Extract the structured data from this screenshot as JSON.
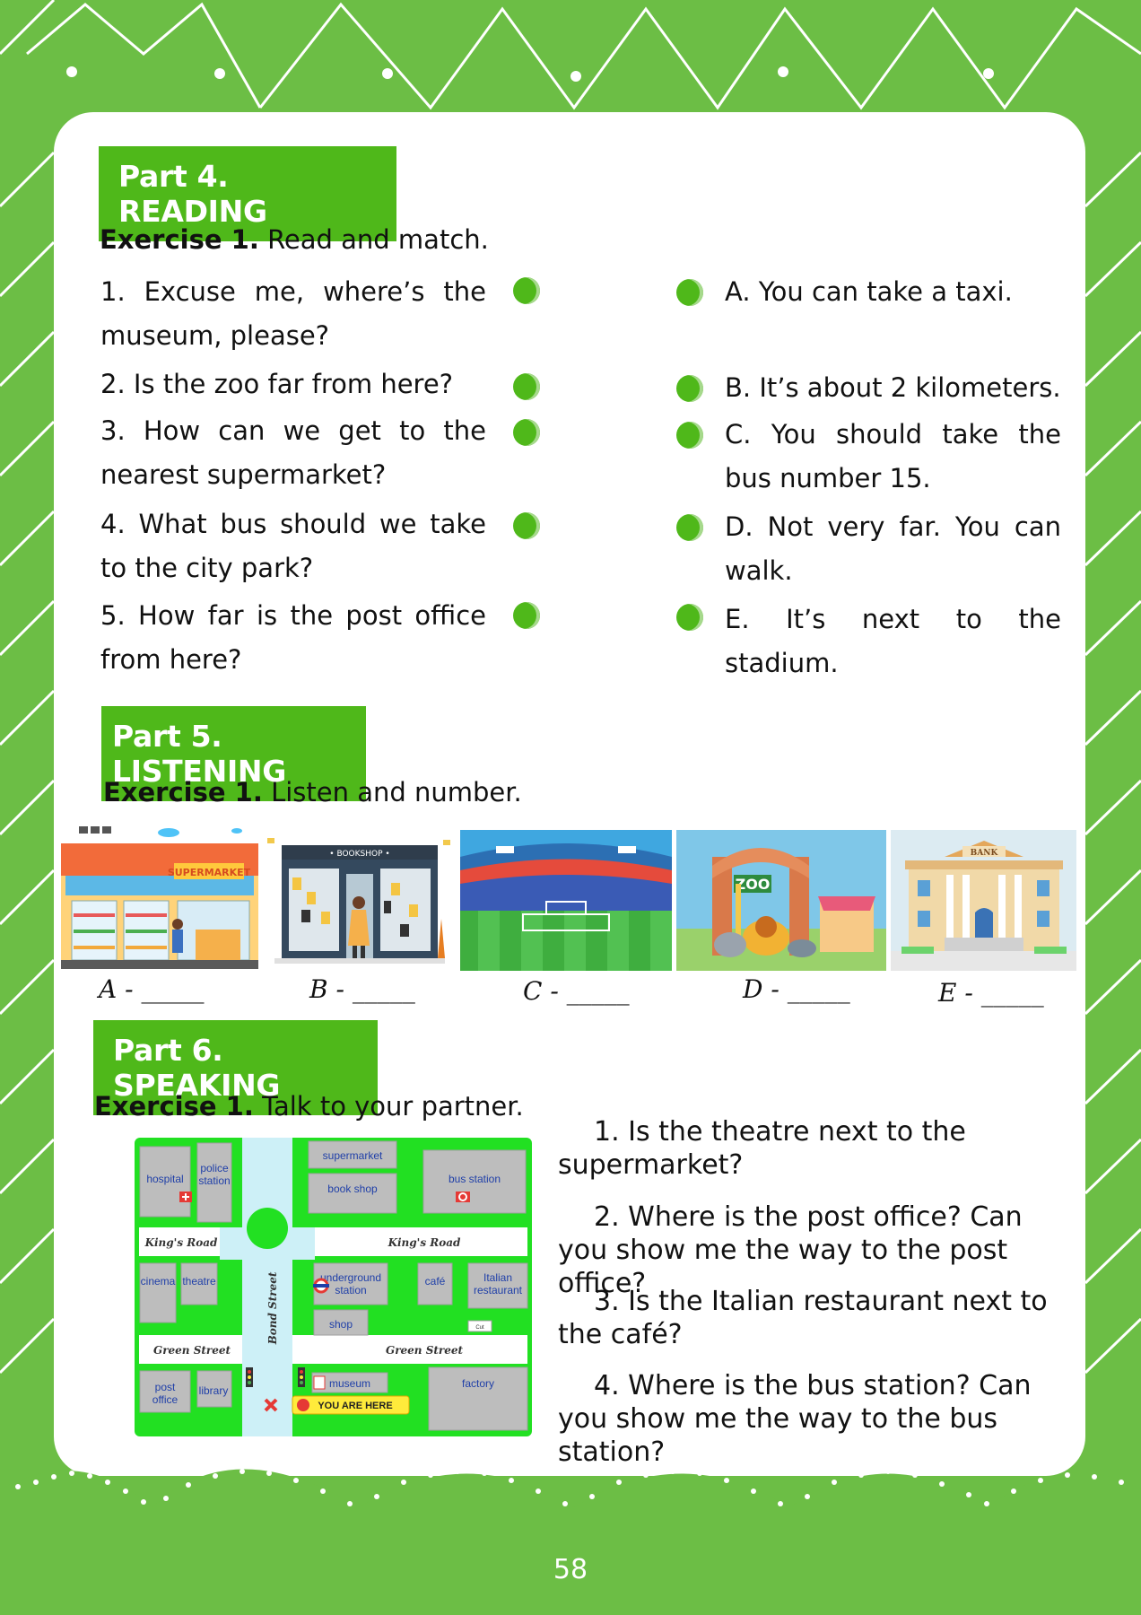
{
  "reading": {
    "header": "Part 4. READING",
    "exercise_label": "Exercise 1.",
    "exercise_text": "Read and match.",
    "questions": [
      "1. Excuse me, where’s the museum, please?",
      "2. Is the zoo far from here?",
      "3. How can we get to the nearest supermarket?",
      "4. What bus should we take to the city park?",
      "5. How far is the post office from here?"
    ],
    "answers": [
      "A. You can take a taxi.",
      "B. It’s about 2 kilometers.",
      "C. You should take the bus number 15.",
      "D. Not very far. You can walk.",
      "E. It’s next to the stadium."
    ]
  },
  "listening": {
    "header": "Part 5. LISTENING",
    "exercise_label": "Exercise 1.",
    "exercise_text": "Listen and number.",
    "pictures": [
      {
        "icon": "supermarket-illustration",
        "sign": "SUPERMARKET",
        "label": "A - _____"
      },
      {
        "icon": "bookshop-illustration",
        "sign": "• BOOKSHOP •",
        "label": "B - _____"
      },
      {
        "icon": "stadium-illustration",
        "label": "C - _____"
      },
      {
        "icon": "zoo-illustration",
        "sign": "ZOO",
        "label": "D - _____"
      },
      {
        "icon": "bank-illustration",
        "sign": "BANK",
        "label": "E - _____"
      }
    ]
  },
  "speaking": {
    "header": "Part 6. SPEAKING",
    "exercise_label": "Exercise 1.",
    "exercise_text": "Talk to your partner.",
    "questions": [
      "1. Is the theatre next to the supermarket?",
      "2. Where is the post office? Can you show me the way to the post office?",
      "3. Is the Italian restaurant next to the café?",
      "4. Where is the bus station? Can you show me the way to the bus station?"
    ],
    "map": {
      "buildings": {
        "hospital": "hospital",
        "police": "police station",
        "supermarket": "supermarket",
        "bookshop": "book shop",
        "busstation": "bus station",
        "cinema": "cinema",
        "theatre": "theatre",
        "underground": "underground station",
        "shop": "shop",
        "cafe": "café",
        "italian": "Italian restaurant",
        "postoffice": "post office",
        "library": "library",
        "museum": "museum",
        "factory": "factory"
      },
      "roads": {
        "kings_left": "King's Road",
        "kings_right": "King's Road",
        "green_left": "Green Street",
        "green_right": "Green Street",
        "bond": "Bond Street"
      },
      "you_are_here": "YOU ARE HERE"
    }
  },
  "page_number": "58",
  "colors": {
    "green": "#6cbe45",
    "header_green": "#4fb81a",
    "map_green": "#22e022"
  }
}
